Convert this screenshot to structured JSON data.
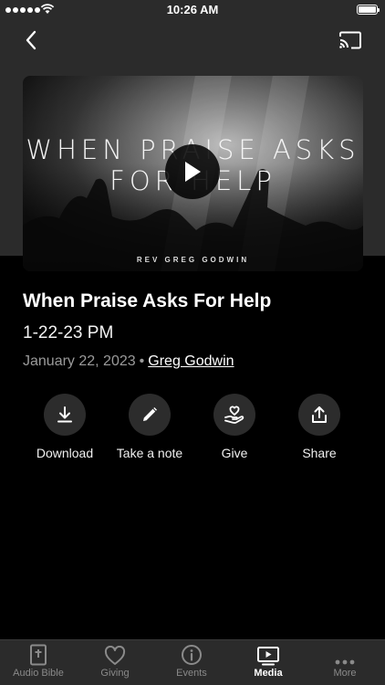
{
  "status_bar": {
    "time": "10:26 AM"
  },
  "video": {
    "thumbnail_title": "WHEN PRAISE ASKS FOR HELP",
    "thumbnail_credit": "REV GREG GODWIN"
  },
  "sermon": {
    "title": "When Praise Asks For Help",
    "subtitle": "1-22-23 PM",
    "date": "January 22, 2023",
    "separator": "•",
    "speaker": "Greg Godwin"
  },
  "actions": [
    {
      "label": "Download",
      "icon": "download-icon"
    },
    {
      "label": "Take a note",
      "icon": "pencil-icon"
    },
    {
      "label": "Give",
      "icon": "giving-hand-icon"
    },
    {
      "label": "Share",
      "icon": "share-icon"
    }
  ],
  "tabs": [
    {
      "label": "Audio Bible",
      "icon": "bible-icon",
      "active": false
    },
    {
      "label": "Giving",
      "icon": "heart-icon",
      "active": false
    },
    {
      "label": "Events",
      "icon": "info-icon",
      "active": false
    },
    {
      "label": "Media",
      "icon": "media-icon",
      "active": true
    },
    {
      "label": "More",
      "icon": "more-icon",
      "active": false
    }
  ],
  "colors": {
    "background": "#000000",
    "chrome": "#2b2b2b",
    "inactive_tab": "#8a8a8a",
    "meta_text": "#9a9a9a"
  }
}
